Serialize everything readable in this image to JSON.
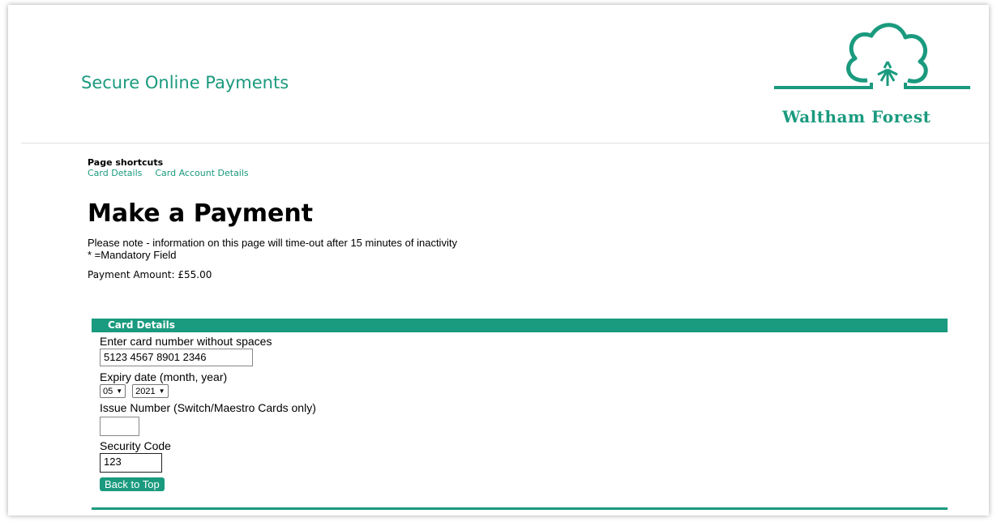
{
  "header": {
    "title": "Secure Online Payments",
    "logo_text": "Waltham Forest"
  },
  "shortcuts": {
    "title": "Page shortcuts",
    "links": [
      "Card Details",
      "Card Account Details"
    ]
  },
  "main": {
    "heading": "Make a Payment",
    "note_line1": "Please note - information on this page will time-out after 15 minutes of inactivity",
    "note_line2": "* =Mandatory Field",
    "payment_amount": "Payment Amount: £55.00"
  },
  "card_details": {
    "section_title": "Card Details",
    "card_number_label": "Enter card number without spaces",
    "card_number_value": "5123 4567 8901 2346",
    "expiry_label": "Expiry date (month, year)",
    "expiry_month": "05",
    "expiry_year": "2021",
    "issue_label": "Issue Number (Switch/Maestro Cards only)",
    "issue_value": "",
    "security_label": "Security Code",
    "security_value": "123",
    "back_to_top": "Back to Top"
  },
  "colors": {
    "accent": "#1a9a7e"
  }
}
